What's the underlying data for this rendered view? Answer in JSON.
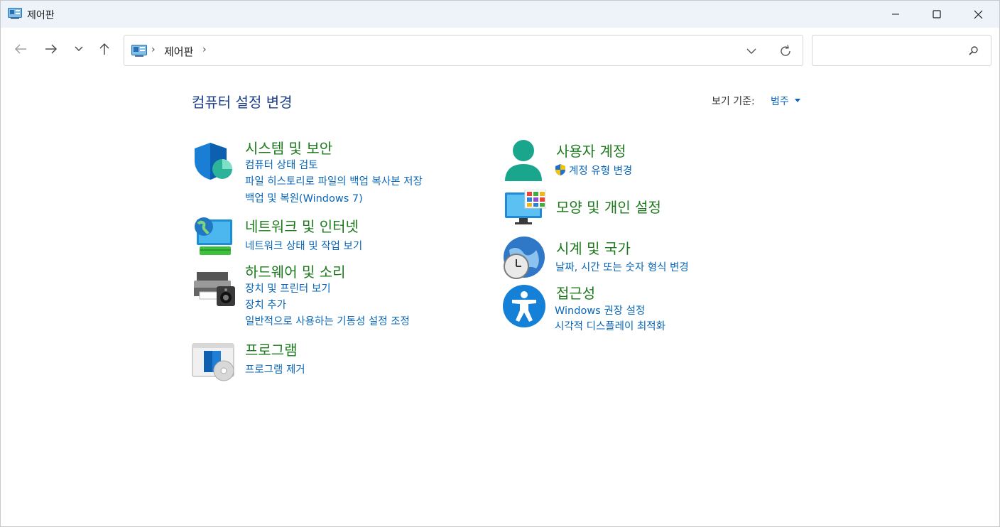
{
  "window": {
    "title": "제어판",
    "minimize_glyph": "—",
    "maximize_glyph": "☐",
    "close_glyph": "✕"
  },
  "navigation": {
    "back_icon": "arrow-left-icon",
    "forward_icon": "arrow-right-icon",
    "recent_icon": "chevron-down-icon",
    "up_icon": "arrow-up-icon"
  },
  "address_bar": {
    "breadcrumb": "제어판",
    "separator": "›"
  },
  "search": {
    "placeholder": ""
  },
  "header": {
    "title": "컴퓨터 설정 변경",
    "view_by_label": "보기 기준:",
    "view_by_value": "범주"
  },
  "categories": {
    "system": {
      "title": "시스템 및 보안",
      "links": [
        "컴퓨터 상태 검토",
        "파일 히스토리로 파일의 백업 복사본 저장",
        "백업 및 복원(Windows 7)"
      ]
    },
    "network": {
      "title": "네트워크 및 인터넷",
      "links": [
        "네트워크 상태 및 작업 보기"
      ]
    },
    "hardware": {
      "title": "하드웨어 및 소리",
      "links": [
        "장치 및 프린터 보기",
        "장치 추가",
        "일반적으로 사용하는 기동성 설정 조정"
      ]
    },
    "programs": {
      "title": "프로그램",
      "links": [
        "프로그램 제거"
      ]
    },
    "accounts": {
      "title": "사용자 계정",
      "links": [
        "계정 유형 변경"
      ]
    },
    "appearance": {
      "title": "모양 및 개인 설정",
      "links": []
    },
    "clock": {
      "title": "시계 및 국가",
      "links": [
        "날짜, 시간 또는 숫자 형식 변경"
      ]
    },
    "ease": {
      "title": "접근성",
      "links": [
        "Windows 권장 설정",
        "시각적 디스플레이 최적화"
      ]
    }
  },
  "colors": {
    "category_title": "#1c7a1c",
    "link": "#0a66b8",
    "heading": "#1e3f8c"
  }
}
